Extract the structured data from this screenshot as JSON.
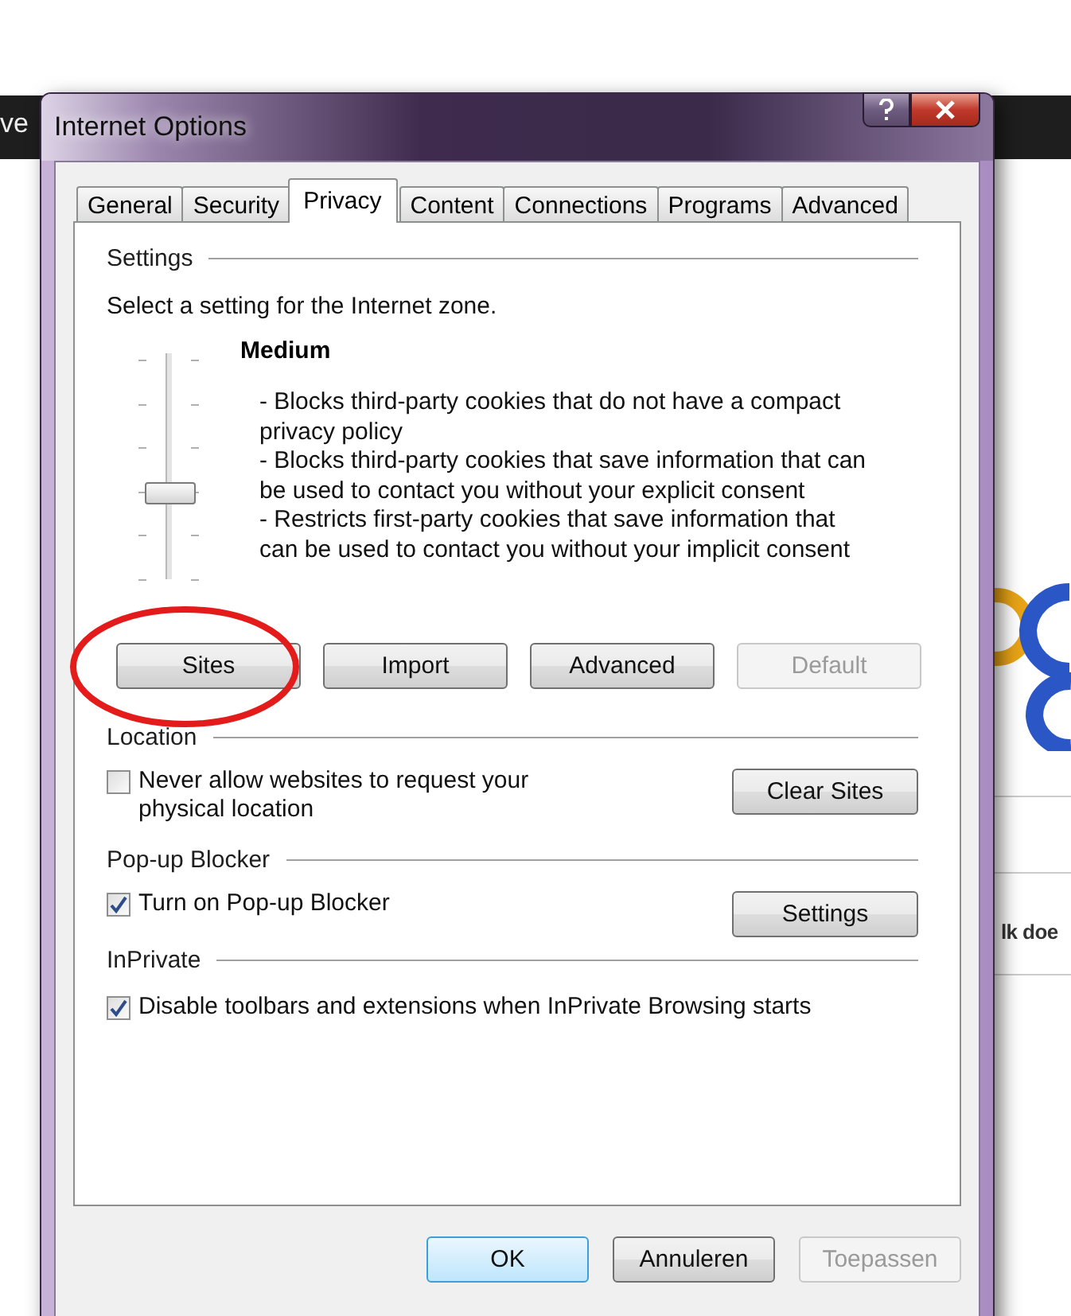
{
  "background": {
    "left_text": "ve",
    "right_text": "lk doe"
  },
  "window": {
    "title": "Internet Options"
  },
  "tabs": [
    {
      "label": "General",
      "selected": false
    },
    {
      "label": "Security",
      "selected": false
    },
    {
      "label": "Privacy",
      "selected": true
    },
    {
      "label": "Content",
      "selected": false
    },
    {
      "label": "Connections",
      "selected": false
    },
    {
      "label": "Programs",
      "selected": false
    },
    {
      "label": "Advanced",
      "selected": false
    }
  ],
  "settings": {
    "heading": "Settings",
    "intro": "Select a setting for the Internet zone.",
    "slider": {
      "level": 0.4
    },
    "level_name": "Medium",
    "description": [
      "- Blocks third-party cookies that do not have a compact privacy policy",
      "- Blocks third-party cookies that save information that can be used to contact you without your explicit consent",
      "- Restricts first-party cookies that save information that can be used to contact you without your implicit consent"
    ],
    "buttons": [
      {
        "label": "Sites",
        "disabled": false,
        "highlighted": true
      },
      {
        "label": "Import",
        "disabled": false,
        "highlighted": false
      },
      {
        "label": "Advanced",
        "disabled": false,
        "highlighted": false
      },
      {
        "label": "Default",
        "disabled": true,
        "highlighted": false
      }
    ]
  },
  "sections": [
    {
      "heading": "Location",
      "checkbox": {
        "label": "Never allow websites to request your physical location",
        "checked": false
      },
      "button": "Clear Sites"
    },
    {
      "heading": "Pop-up Blocker",
      "checkbox": {
        "label": "Turn on Pop-up Blocker",
        "checked": true
      },
      "button": "Settings"
    },
    {
      "heading": "InPrivate",
      "checkbox": {
        "label": "Disable toolbars and extensions when InPrivate Browsing starts",
        "checked": true
      }
    }
  ],
  "footer_buttons": [
    {
      "label": "OK",
      "default": true,
      "disabled": false
    },
    {
      "label": "Annuleren",
      "default": false,
      "disabled": false
    },
    {
      "label": "Toepassen",
      "default": false,
      "disabled": true
    }
  ]
}
